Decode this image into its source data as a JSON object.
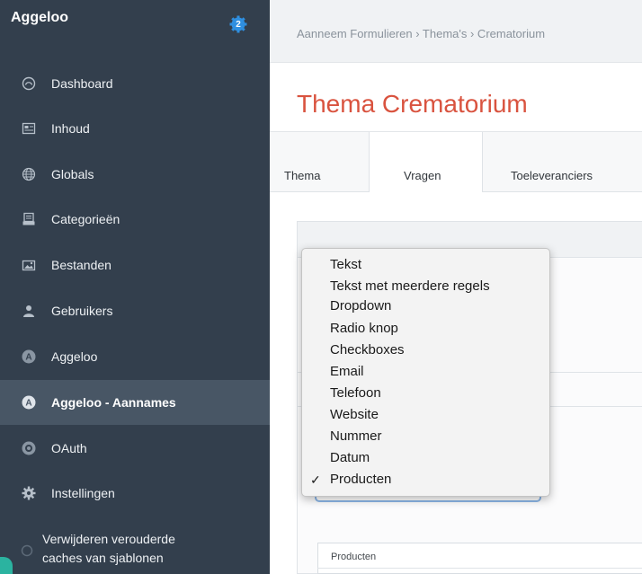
{
  "sidebar": {
    "brand": "Aggeloo",
    "badge_count": "2",
    "items": [
      {
        "label": "Dashboard",
        "icon": "dashboard-icon"
      },
      {
        "label": "Inhoud",
        "icon": "entries-icon"
      },
      {
        "label": "Globals",
        "icon": "globe-icon"
      },
      {
        "label": "Categorieën",
        "icon": "categories-icon"
      },
      {
        "label": "Bestanden",
        "icon": "assets-icon"
      },
      {
        "label": "Gebruikers",
        "icon": "users-icon"
      },
      {
        "label": "Aggeloo",
        "icon": "plugin-a-icon"
      },
      {
        "label": "Aggeloo - Aannames",
        "icon": "plugin-a-icon",
        "active": true
      },
      {
        "label": "OAuth",
        "icon": "oauth-icon"
      },
      {
        "label": "Instellingen",
        "icon": "gear-icon"
      },
      {
        "label_line1": "Verwijderen verouderde",
        "label_line2": "caches van sjablonen",
        "icon": "progress-icon"
      }
    ]
  },
  "breadcrumb": "Aanneem Formulieren › Thema's › Crematorium",
  "page_title": "Thema Crematorium",
  "tabs": [
    {
      "label": "Thema"
    },
    {
      "label": "Vragen",
      "active": true
    },
    {
      "label": "Toeleveranciers"
    }
  ],
  "dropdown": {
    "options": [
      "Tekst",
      "Tekst met meerdere regels",
      "Dropdown",
      "Radio knop",
      "Checkboxes",
      "Email",
      "Telefoon",
      "Website",
      "Nummer",
      "Datum",
      "Producten"
    ],
    "selected": "Producten",
    "check": "✓"
  },
  "products_label": "Producten",
  "colors": {
    "sidebar_bg": "#333f4d",
    "active_item_bg": "#485665",
    "title_red": "#d9533f",
    "badge_blue": "#2f8fe0"
  }
}
